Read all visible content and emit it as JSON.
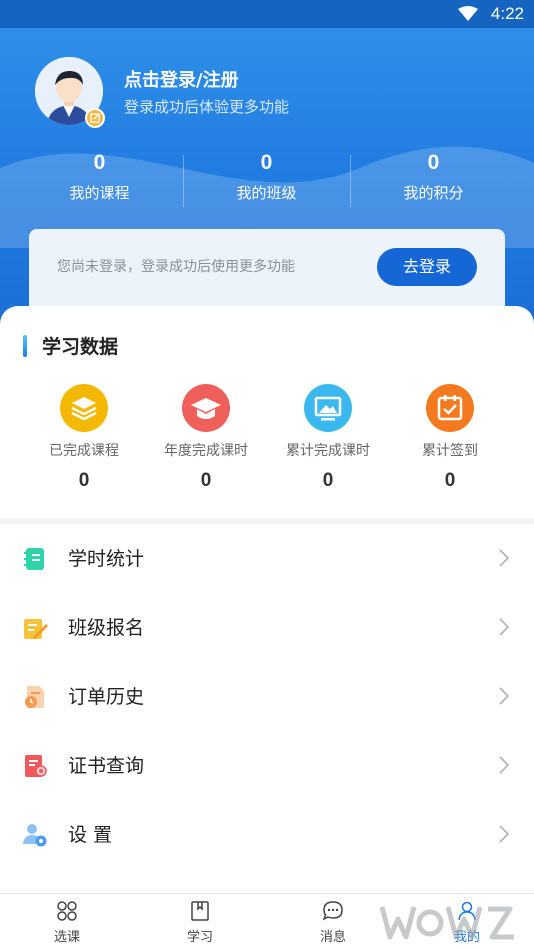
{
  "status_bar": {
    "time": "4:22"
  },
  "profile": {
    "login_title": "点击登录/注册",
    "login_subtitle": "登录成功后体验更多功能"
  },
  "stats": [
    {
      "value": "0",
      "label": "我的课程"
    },
    {
      "value": "0",
      "label": "我的班级"
    },
    {
      "value": "0",
      "label": "我的积分"
    }
  ],
  "notice": {
    "text": "您尚未登录，登录成功后使用更多功能",
    "button": "去登录"
  },
  "study_data": {
    "title": "学习数据",
    "metrics": [
      {
        "label": "已完成课程",
        "value": "0",
        "icon": "layers-icon",
        "color": "#f5b800"
      },
      {
        "label": "年度完成课时",
        "value": "0",
        "icon": "graduation-cap-icon",
        "color": "#f0605a"
      },
      {
        "label": "累计完成课时",
        "value": "0",
        "icon": "monitor-icon",
        "color": "#3ab8ef"
      },
      {
        "label": "累计签到",
        "value": "0",
        "icon": "calendar-check-icon",
        "color": "#f57a1f"
      }
    ]
  },
  "menu": [
    {
      "label": "学时统计",
      "icon": "notebook-icon",
      "color": "#2fd3a8"
    },
    {
      "label": "班级报名",
      "icon": "edit-note-icon",
      "color": "#f5c23a"
    },
    {
      "label": "订单历史",
      "icon": "order-history-icon",
      "color": "#f79a52"
    },
    {
      "label": "证书查询",
      "icon": "certificate-icon",
      "color": "#f0585e"
    },
    {
      "label": "设 置",
      "icon": "user-settings-icon",
      "color": "#4b9bf2"
    }
  ],
  "tabs": [
    {
      "label": "选课",
      "icon": "grid-icon",
      "active": false
    },
    {
      "label": "学习",
      "icon": "book-icon",
      "active": false
    },
    {
      "label": "消息",
      "icon": "chat-icon",
      "active": false
    },
    {
      "label": "我的",
      "icon": "person-icon",
      "active": true
    }
  ]
}
